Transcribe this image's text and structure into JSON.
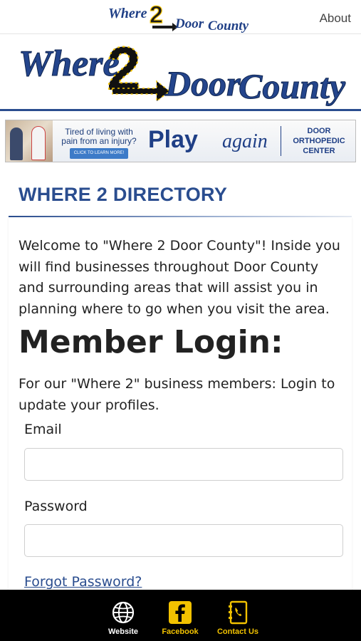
{
  "header": {
    "logo": {
      "word1": "Where",
      "numeral": "2",
      "word2": "Door",
      "word3": "County"
    },
    "about_label": "About"
  },
  "hero": {
    "logo": {
      "word1": "Where",
      "numeral": "2",
      "word2": "Door",
      "word3": "County"
    }
  },
  "ad_banner": {
    "tagline_line1": "Tired of living with",
    "tagline_line2": "pain from an injury?",
    "cta": "CLICK TO LEARN MORE!",
    "headline_bold": "Play",
    "headline_script": "again",
    "brand_line1": "DOOR",
    "brand_line2": "ORTHOPEDIC",
    "brand_line3": "CENTER"
  },
  "main": {
    "section_title": "WHERE 2 DIRECTORY",
    "welcome_text": "Welcome to \"Where 2 Door County\"! Inside you will find businesses throughout Door County and surrounding areas that will assist you in planning where to go when you visit the area.",
    "login_heading": "Member Login:",
    "login_subtext": "For our \"Where 2\" business members: Login to update your profiles.",
    "email_label": "Email",
    "email_value": "",
    "password_label": "Password",
    "password_value": "",
    "forgot_password_label": "Forgot Password?"
  },
  "bottom_nav": {
    "items": [
      {
        "label": "Website",
        "icon": "globe-icon"
      },
      {
        "label": "Facebook",
        "icon": "facebook-icon"
      },
      {
        "label": "Contact Us",
        "icon": "phone-book-icon"
      }
    ]
  },
  "colors": {
    "brand_blue": "#2a4d8f",
    "accent_yellow": "#f2c200",
    "nav_background": "#000000"
  }
}
